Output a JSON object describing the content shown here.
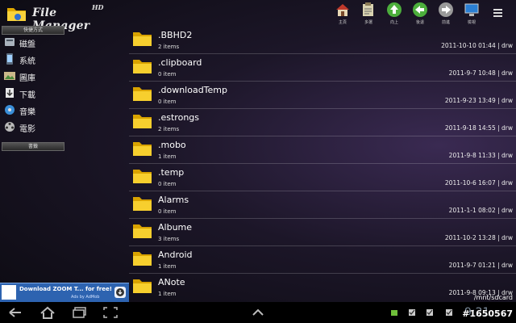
{
  "app": {
    "title": "File Manager",
    "edition": "HD"
  },
  "toolbar": [
    {
      "name": "home",
      "label": "主頁",
      "icon": "home-icon"
    },
    {
      "name": "multi-select",
      "label": "多選",
      "icon": "clipboard-icon"
    },
    {
      "name": "up",
      "label": "向上",
      "icon": "arrow-up-icon"
    },
    {
      "name": "back",
      "label": "後退",
      "icon": "arrow-left-icon"
    },
    {
      "name": "forward",
      "label": "前進",
      "icon": "arrow-right-icon"
    },
    {
      "name": "view",
      "label": "檢視",
      "icon": "monitor-icon"
    }
  ],
  "sidebar": {
    "section1": "快捷方式",
    "items": [
      {
        "label": "磁盤",
        "icon": "disk-icon"
      },
      {
        "label": "系統",
        "icon": "phone-icon"
      },
      {
        "label": "圖庫",
        "icon": "picture-icon"
      },
      {
        "label": "下載",
        "icon": "download-icon"
      },
      {
        "label": "音樂",
        "icon": "music-icon"
      },
      {
        "label": "電影",
        "icon": "film-icon"
      }
    ],
    "section2": "書籤"
  },
  "files": [
    {
      "name": ".BBHD2",
      "count": "2 items",
      "meta": ""
    },
    {
      "name": ".clipboard",
      "count": "0 item",
      "meta": "2011-9-7 10:48 | drw"
    },
    {
      "name": ".downloadTemp",
      "count": "0 item",
      "meta": "2011-9-23 13:49 | drw"
    },
    {
      "name": ".estrongs",
      "count": "2 items",
      "meta": "2011-9-18 14:55 | drw"
    },
    {
      "name": ".mobo",
      "count": "1 item",
      "meta": "2011-9-8 11:33 | drw"
    },
    {
      "name": ".temp",
      "count": "0 item",
      "meta": "2011-10-6 16:07 | drw"
    },
    {
      "name": "Alarms",
      "count": "0 item",
      "meta": "2011-1-1 08:02 | drw"
    },
    {
      "name": "Albume",
      "count": "3 items",
      "meta": "2011-10-2 13:28 | drw"
    },
    {
      "name": "Android",
      "count": "1 item",
      "meta": "2011-9-7 01:21 | drw"
    },
    {
      "name": "ANote",
      "count": "1 item",
      "meta": "2011-9-8 09:13 | drw"
    }
  ],
  "first_row_meta": "2011-10-10 01:44 | drw",
  "ad": {
    "title": "Download ZOOM T... for free!",
    "by": "Ads by AdMob"
  },
  "path": "/mnt/sdcard",
  "status": {
    "clock": "9:21"
  },
  "watermark": "#1650567",
  "colors": {
    "folder": "#f3c623",
    "ad_bg": "#2d63b0",
    "system_bar": "#000000"
  }
}
